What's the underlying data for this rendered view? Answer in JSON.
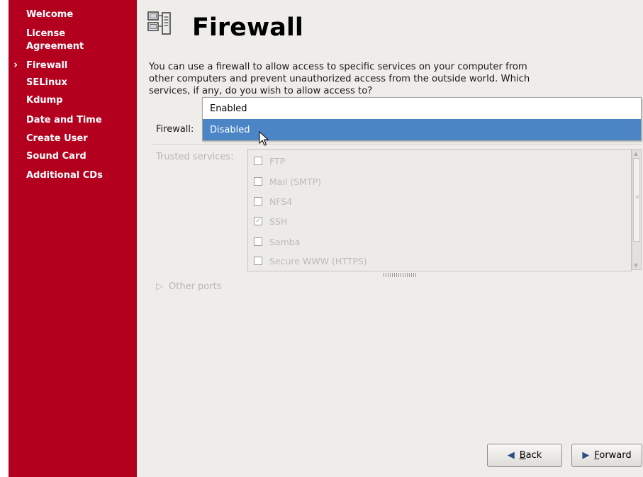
{
  "sidebar": {
    "items": [
      {
        "label": "Welcome",
        "current": false
      },
      {
        "label": "License",
        "current": false
      },
      {
        "label": "Agreement",
        "current": false
      },
      {
        "label": "Firewall",
        "current": true
      },
      {
        "label": "SELinux",
        "current": false
      },
      {
        "label": "Kdump",
        "current": false
      },
      {
        "label": "Date and Time",
        "current": false
      },
      {
        "label": "Create User",
        "current": false
      },
      {
        "label": "Sound Card",
        "current": false
      },
      {
        "label": "Additional CDs",
        "current": false
      }
    ]
  },
  "header": {
    "title": "Firewall",
    "icon": "firewall-computers-icon"
  },
  "intro_text": "You can use a firewall to allow access to specific services on your computer from other computers and prevent unauthorized access from the outside world. Which services, if any, do you wish to allow access to?",
  "firewall": {
    "label": "Firewall:",
    "options": [
      "Enabled",
      "Disabled"
    ],
    "selected": "Disabled"
  },
  "trusted": {
    "label": "Trusted services:",
    "services": [
      {
        "name": "FTP",
        "checked": false
      },
      {
        "name": "Mail (SMTP)",
        "checked": false
      },
      {
        "name": "NFS4",
        "checked": false
      },
      {
        "name": "SSH",
        "checked": true
      },
      {
        "name": "Samba",
        "checked": false
      },
      {
        "name": "Secure WWW (HTTPS)",
        "checked": false
      }
    ]
  },
  "other_ports": {
    "label": "Other ports"
  },
  "buttons": {
    "back": {
      "label_underlined": "B",
      "label_rest": "ack"
    },
    "forward": {
      "label_underlined": "F",
      "label_rest": "orward"
    }
  },
  "colors": {
    "sidebar": "#b3001f",
    "selection": "#4b85c6",
    "panel": "#efedea"
  }
}
